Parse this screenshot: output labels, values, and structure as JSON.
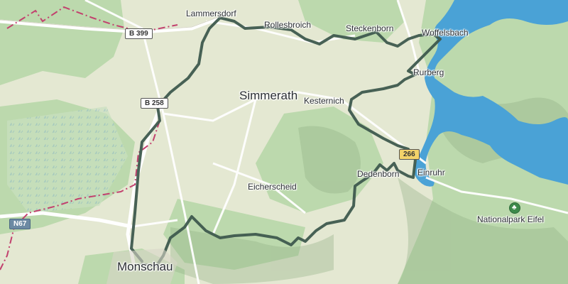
{
  "places": {
    "lammersdorf": "Lammersdorf",
    "rollesbroich": "Rollesbroich",
    "steckenborn": "Steckenborn",
    "woffelsbach": "Woffelsbach",
    "rurberg": "Rurberg",
    "simmerath": "Simmerath",
    "kesternich": "Kesternich",
    "dedenborn": "Dedenborn",
    "einruhr": "Einruhr",
    "eicherscheid": "Eicherscheid",
    "monschau": "Monschau",
    "nationalpark": "Nationalpark Eifel"
  },
  "roads": {
    "b399": "B 399",
    "b258": "B 258",
    "road266": "266",
    "n67": "N67"
  },
  "icons": {
    "park": "tree-icon"
  },
  "colors": {
    "route": "#3e5a4e",
    "water": "#4aa2d6",
    "border": "#c2416e",
    "forest": "#b9d7a9",
    "land": "#e4e8d2"
  }
}
